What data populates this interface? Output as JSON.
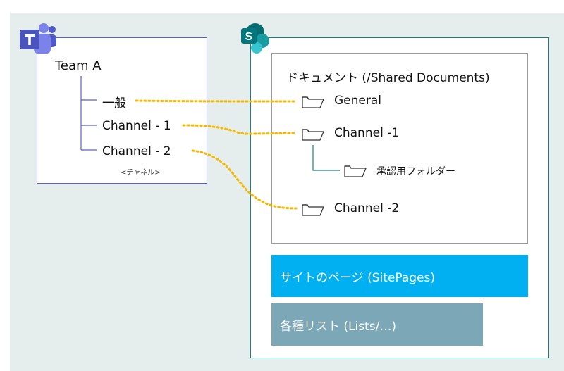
{
  "teams": {
    "team_name": "Team A",
    "channels": [
      "一般",
      "Channel - 1",
      "Channel - 2"
    ],
    "caption": "<チャネル>"
  },
  "sharepoint": {
    "library_title": "ドキュメント (/Shared Documents)",
    "folders": [
      "General",
      "Channel -1",
      "Channel -2"
    ],
    "subfolder": "承認用フォルダー",
    "site_pages": "サイトのページ (SitePages)",
    "lists": "各種リスト (Lists/…)"
  },
  "colors": {
    "teams_accent": "#5b5fc7",
    "sharepoint_accent": "#1a7f80",
    "link_dots": "#f5b800",
    "site_pages_bar": "#00b0f0",
    "lists_bar": "#7ba7b7",
    "background": "#e5eeec"
  },
  "icons": {
    "teams": "teams-logo-icon",
    "sharepoint": "sharepoint-logo-icon",
    "folder": "folder-icon"
  }
}
